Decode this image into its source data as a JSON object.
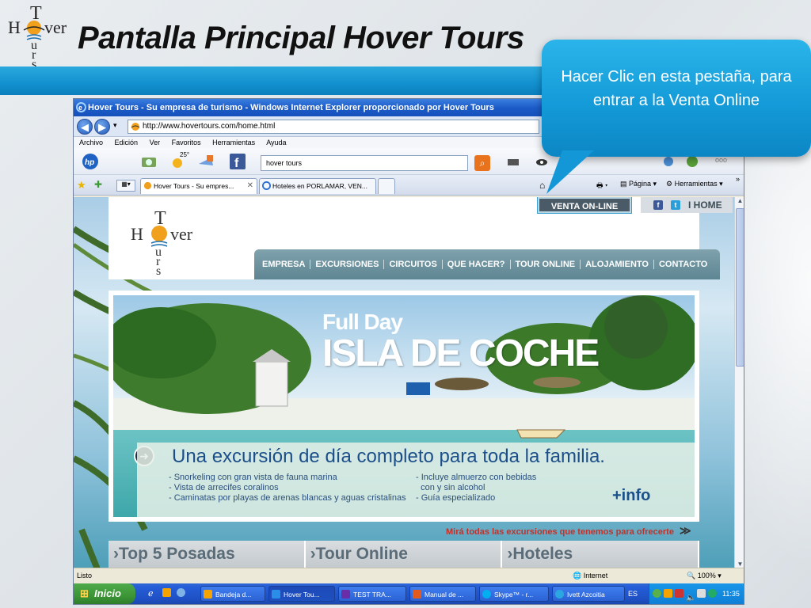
{
  "slide": {
    "title": "Pantalla Principal Hover Tours",
    "logo_letters": {
      "top": "T",
      "mid_left": "H",
      "mid_right": "ver",
      "bottom": [
        "u",
        "r",
        "s"
      ]
    },
    "callout_text": "Hacer Clic en esta pestaña, para entrar a la Venta Online"
  },
  "browser": {
    "title": "Hover Tours - Su empresa de turismo - Windows Internet Explorer proporcionado por Hover Tours",
    "url": "http://www.hovertours.com/home.html",
    "menu": [
      "Archivo",
      "Edición",
      "Ver",
      "Favoritos",
      "Herramientas",
      "Ayuda"
    ],
    "weather": "25°",
    "search_query": "hover tours",
    "tabs": [
      {
        "label": "Hover Tours - Su empres...",
        "active": true
      },
      {
        "label": "Hoteles en PORLAMAR, VEN...",
        "active": false
      }
    ],
    "commands": {
      "page": "Página",
      "tools": "Herramientas"
    },
    "status_left": "Listo",
    "status_zone": "Internet",
    "zoom": "100%"
  },
  "site": {
    "venta_online": "VENTA ON-LINE",
    "home_link": "I  HOME",
    "social": [
      "f",
      "t"
    ],
    "nav": [
      "EMPRESA",
      "EXCURSIONES",
      "CIRCUITOS",
      "QUE HACER?",
      "TOUR ONLINE",
      "ALOJAMIENTO",
      "CONTACTO"
    ],
    "banner": {
      "title_line1": "Full Day",
      "title_line2": "ISLA DE COCHE",
      "headline": "Una excursión de día completo para toda la familia.",
      "list_left": [
        "- Snorkeling con gran vista de fauna marina",
        "- Vista de arrecifes coralinos",
        "- Caminatas por playas de arenas blancas y aguas cristalinas"
      ],
      "list_right": [
        "- Incluye almuerzo con bebidas",
        "  con y sin alcohol",
        "- Guía especializado"
      ],
      "info": "+info"
    },
    "see_more": "Mirá todas las excursiones que tenemos para ofrecerte",
    "bottom_boxes": [
      "›Top 5 Posadas",
      "›Tour Online",
      "›Hoteles"
    ]
  },
  "taskbar": {
    "start": "Inicio",
    "items": [
      {
        "label": "Bandeja d...",
        "color": "#f4a300"
      },
      {
        "label": "Hover Tou...",
        "color": "#2a8ee8",
        "active": true
      },
      {
        "label": "TEST  TRA...",
        "color": "#6a2da8"
      },
      {
        "label": "Manual de ...",
        "color": "#e35b1c"
      },
      {
        "label": "Skype™ - r...",
        "color": "#00aff0"
      },
      {
        "label": "Ivett Azcoitia",
        "color": "#2aa7e0"
      }
    ],
    "lang": "ES",
    "clock": "11:35"
  },
  "colors": {
    "accent_blue": "#1290cf",
    "nav_teal": "#6b8f9b",
    "venta_bg": "#4a5a66",
    "see_more_red": "#c0322b"
  }
}
